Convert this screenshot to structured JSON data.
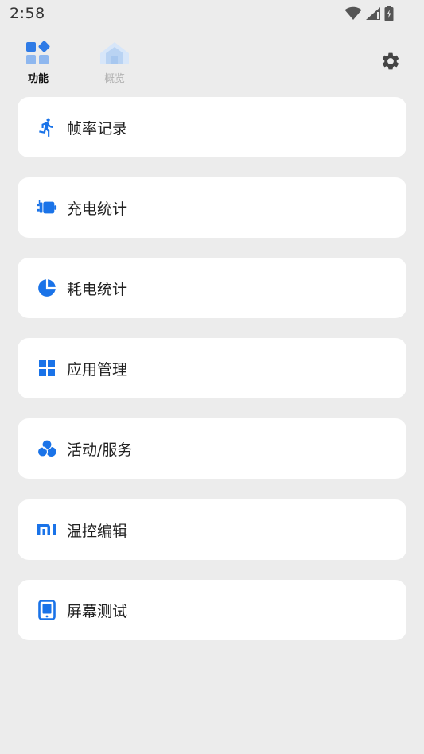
{
  "status_bar": {
    "time": "2:58",
    "icons": [
      "wifi-icon",
      "signal-icon",
      "battery-icon"
    ]
  },
  "nav": {
    "tabs": [
      {
        "label": "功能",
        "icon": "functions-icon",
        "selected": true
      },
      {
        "label": "概览",
        "icon": "overview-icon",
        "selected": false
      }
    ],
    "settings_icon": "gear-icon"
  },
  "menu": {
    "items": [
      {
        "label": "帧率记录",
        "icon": "running-person-icon"
      },
      {
        "label": "充电统计",
        "icon": "charger-plug-icon"
      },
      {
        "label": "耗电统计",
        "icon": "pie-chart-icon"
      },
      {
        "label": "应用管理",
        "icon": "app-grid-icon"
      },
      {
        "label": "活动/服务",
        "icon": "circles-icon"
      },
      {
        "label": "温控编辑",
        "icon": "mi-logo-icon"
      },
      {
        "label": "屏幕测试",
        "icon": "tablet-icon"
      }
    ]
  },
  "colors": {
    "accent": "#1a73e8",
    "background": "#ececec",
    "card": "#ffffff",
    "tab_inactive": "#b3b3b3"
  }
}
